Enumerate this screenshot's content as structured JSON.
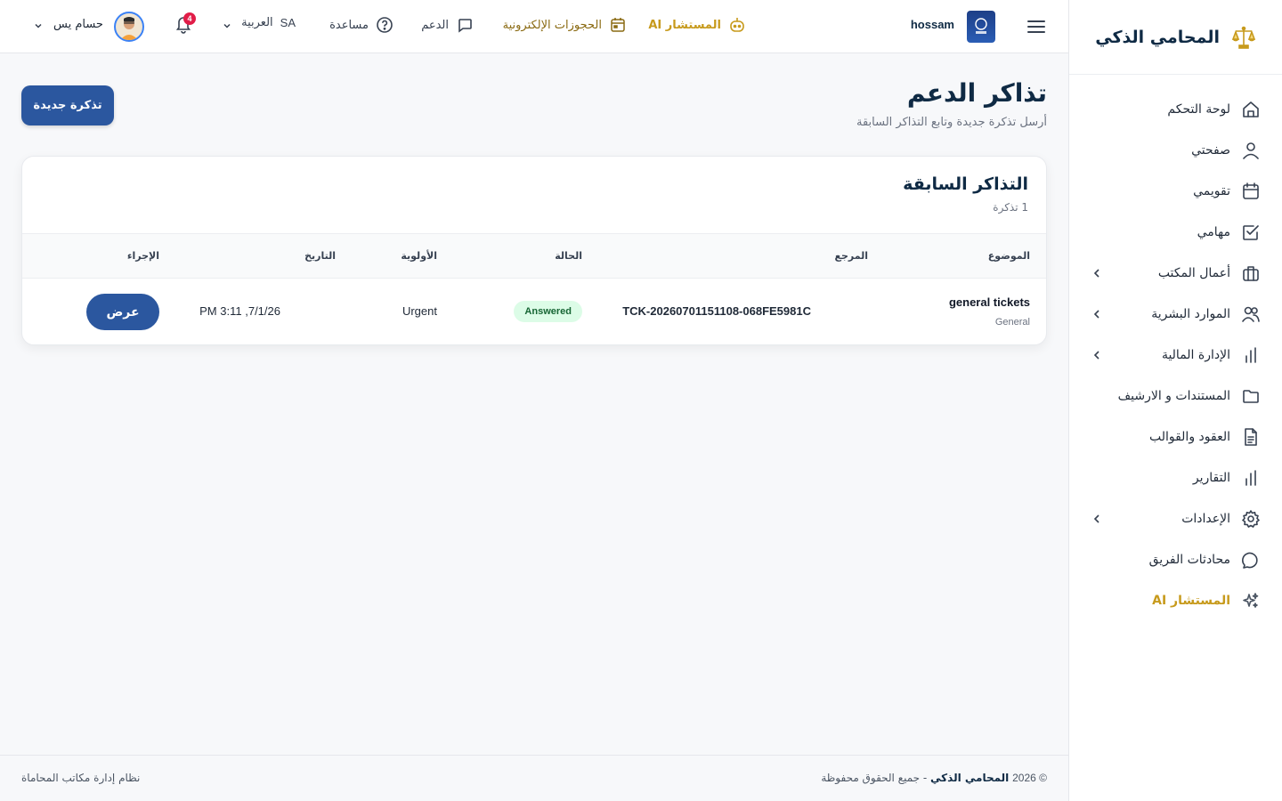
{
  "brand": {
    "title": "المحامي الذكي"
  },
  "sidebar": {
    "items": [
      {
        "label": "لوحة التحكم",
        "icon": "home-icon",
        "chevron": false
      },
      {
        "label": "صفحتي",
        "icon": "user-icon",
        "chevron": false
      },
      {
        "label": "تقويمي",
        "icon": "calendar-icon",
        "chevron": false
      },
      {
        "label": "مهامي",
        "icon": "check-square-icon",
        "chevron": false
      },
      {
        "label": "أعمال المكتب",
        "icon": "briefcase-icon",
        "chevron": true
      },
      {
        "label": "الموارد البشرية",
        "icon": "users-icon",
        "chevron": true
      },
      {
        "label": "الإدارة المالية",
        "icon": "bar-chart-icon",
        "chevron": true
      },
      {
        "label": "المستندات و الارشيف",
        "icon": "folder-icon",
        "chevron": false
      },
      {
        "label": "العقود والقوالب",
        "icon": "file-text-icon",
        "chevron": false
      },
      {
        "label": "التقارير",
        "icon": "bar-chart-icon",
        "chevron": false
      },
      {
        "label": "الإعدادات",
        "icon": "gear-icon",
        "chevron": true
      },
      {
        "label": "محادثات الفريق",
        "icon": "chat-icon",
        "chevron": false
      },
      {
        "label": "المستشار AI",
        "icon": "sparkles-icon",
        "chevron": false
      }
    ]
  },
  "header": {
    "office_name": "hossam",
    "ai_label": "المستشار AI",
    "bookings_label": "الحجوزات الإلكترونية",
    "support_label": "الدعم",
    "help_label": "مساعدة",
    "language_label": "العربية",
    "language_code": "SA",
    "notifications_count": "4",
    "user_name": "حسام يس"
  },
  "main": {
    "title": "تذاكر الدعم",
    "subtitle": "أرسل تذكرة جديدة وتابع التذاكر السابقة",
    "new_ticket_label": "تذكرة جديدة",
    "card": {
      "title": "التذاكر السابقة",
      "count": "1 تذكرة",
      "columns": {
        "subject": "الموضوع",
        "reference": "المرجع",
        "status": "الحالة",
        "priority": "الأولوية",
        "date": "التاريخ",
        "action": "الإجراء"
      },
      "rows": [
        {
          "subject": "general tickets",
          "category": "General",
          "reference": "TCK-20260701151108-068FE5981C",
          "status": "Answered",
          "priority": "Urgent",
          "date": "7/1/26, 3:11 PM",
          "action": "عرض"
        }
      ]
    }
  },
  "footer": {
    "copyright_prefix": "© 2026",
    "brand": "المحامي الذكي",
    "rights": "- جميع الحقوق محفوظة",
    "system_name": "نظام إدارة مكاتب المحاماة"
  },
  "colors": {
    "primary": "#2b579f",
    "navy": "#0f2a44",
    "gold": "#c79a1c",
    "status_answered_bg": "#dcfce7",
    "status_answered_fg": "#166534",
    "badge": "#e11d48"
  }
}
